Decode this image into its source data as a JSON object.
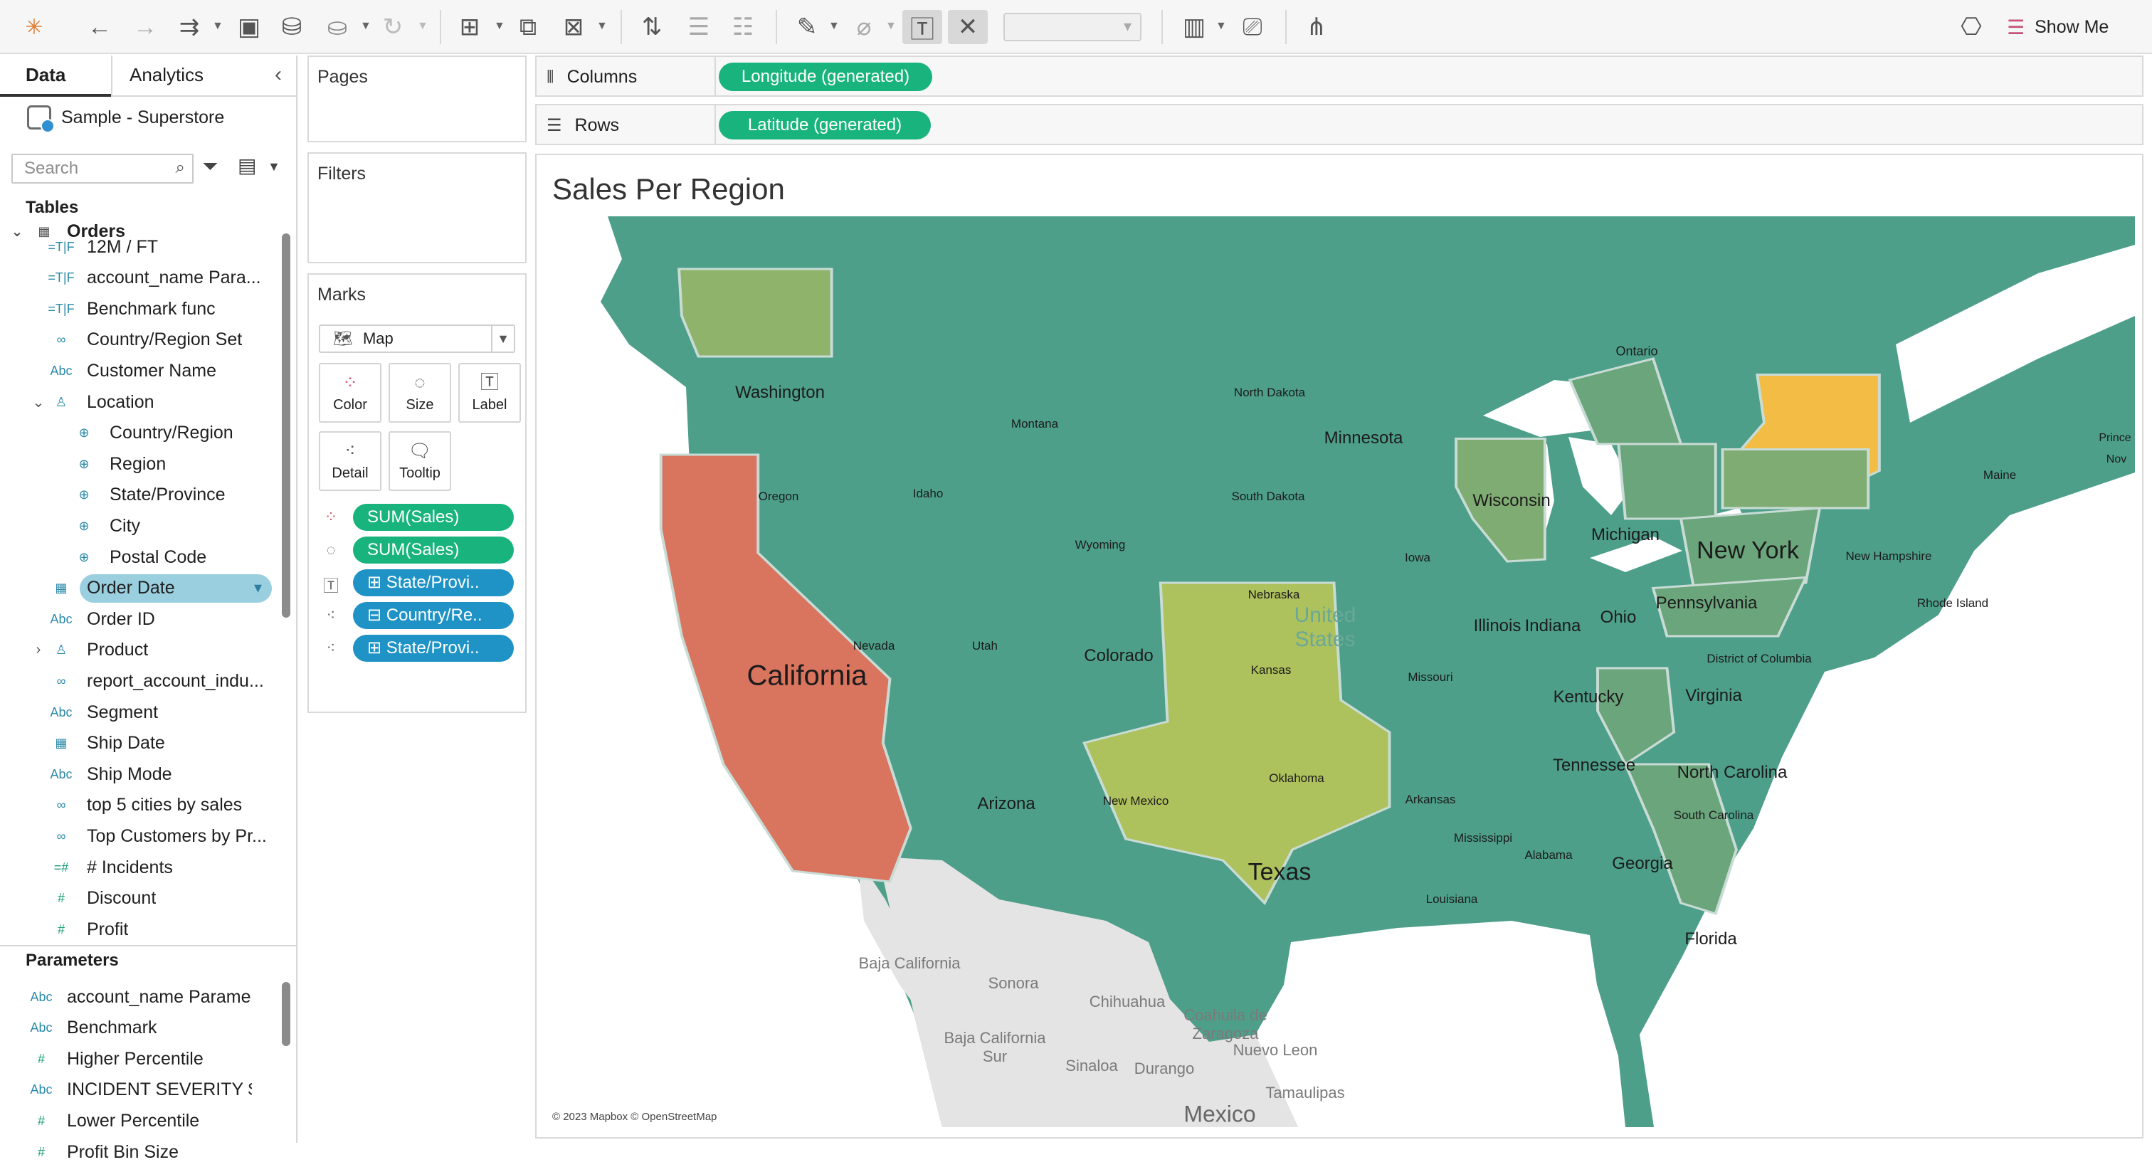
{
  "toolbar": {
    "show_me_label": "Show Me"
  },
  "left_pane": {
    "tabs": [
      "Data",
      "Analytics"
    ],
    "datasource": "Sample - Superstore",
    "search_placeholder": "Search",
    "tables_heading": "Tables",
    "orders_label": "Orders",
    "fields": [
      {
        "icon": "=T|F",
        "label": "12M / FT"
      },
      {
        "icon": "=T|F",
        "label": "account_name Para..."
      },
      {
        "icon": "=T|F",
        "label": "Benchmark func"
      },
      {
        "icon": "∞",
        "label": "Country/Region Set"
      },
      {
        "icon": "Abc",
        "label": "Customer Name"
      },
      {
        "icon": "♙",
        "label": "Location"
      },
      {
        "icon": "⊕",
        "label": "Country/Region"
      },
      {
        "icon": "⊕",
        "label": "Region"
      },
      {
        "icon": "⊕",
        "label": "State/Province"
      },
      {
        "icon": "⊕",
        "label": "City"
      },
      {
        "icon": "⊕",
        "label": "Postal Code"
      },
      {
        "icon": "▦",
        "label": "Order Date"
      },
      {
        "icon": "Abc",
        "label": "Order ID"
      },
      {
        "icon": "♙",
        "label": "Product"
      },
      {
        "icon": "∞",
        "label": "report_account_indu..."
      },
      {
        "icon": "Abc",
        "label": "Segment"
      },
      {
        "icon": "▦",
        "label": "Ship Date"
      },
      {
        "icon": "Abc",
        "label": "Ship Mode"
      },
      {
        "icon": "∞",
        "label": "top 5 cities by sales"
      },
      {
        "icon": "∞",
        "label": "Top Customers by Pr..."
      },
      {
        "icon": "=#",
        "label": "# Incidents"
      },
      {
        "icon": "#",
        "label": "Discount"
      },
      {
        "icon": "#",
        "label": "Profit"
      }
    ],
    "parameters_heading": "Parameters",
    "parameters": [
      {
        "icon": "Abc",
        "label": "account_name Parame..."
      },
      {
        "icon": "Abc",
        "label": "Benchmark"
      },
      {
        "icon": "#",
        "label": "Higher Percentile"
      },
      {
        "icon": "Abc",
        "label": "INCIDENT SEVERITY $ ..."
      },
      {
        "icon": "#",
        "label": "Lower Percentile"
      },
      {
        "icon": "#",
        "label": "Profit Bin Size"
      }
    ]
  },
  "cards": {
    "pages": "Pages",
    "filters": "Filters",
    "marks": "Marks",
    "mark_type": "Map",
    "mark_buttons": [
      "Color",
      "Size",
      "Label",
      "Detail",
      "Tooltip"
    ],
    "mark_pills": [
      {
        "icon": "color",
        "label": "SUM(Sales)",
        "kind": "green"
      },
      {
        "icon": "size",
        "label": "SUM(Sales)",
        "kind": "green"
      },
      {
        "icon": "label",
        "label": "⊞ State/Provi..",
        "kind": "blue"
      },
      {
        "icon": "detail",
        "label": "⊟ Country/Re..",
        "kind": "blue"
      },
      {
        "icon": "detail",
        "label": "⊞ State/Provi..",
        "kind": "blue"
      }
    ]
  },
  "shelves": {
    "columns_label": "Columns",
    "columns_pill": "Longitude (generated)",
    "rows_label": "Rows",
    "rows_pill": "Latitude (generated)"
  },
  "viz": {
    "title": "Sales Per Region",
    "credit": "© 2023 Mapbox © OpenStreetMap",
    "country_label": "United States",
    "colors": {
      "low": "#4d9f8a",
      "mid_low": "#8fb36a",
      "mid": "#adc15c",
      "high": "#f3bd45",
      "max": "#d9745f",
      "outside": "#e4e4e4",
      "water": "#ffffff"
    },
    "states": [
      {
        "name": "Washington",
        "size": "med",
        "color": "#8fb36a"
      },
      {
        "name": "Montana",
        "size": "small"
      },
      {
        "name": "North Dakota",
        "size": "small"
      },
      {
        "name": "Minnesota",
        "size": "med"
      },
      {
        "name": "Oregon",
        "size": "small"
      },
      {
        "name": "Idaho",
        "size": "small"
      },
      {
        "name": "South Dakota",
        "size": "small"
      },
      {
        "name": "Wisconsin",
        "size": "med"
      },
      {
        "name": "Michigan",
        "size": "med",
        "color": "#6ba57c"
      },
      {
        "name": "Wyoming",
        "size": "small"
      },
      {
        "name": "Iowa",
        "size": "small"
      },
      {
        "name": "Nebraska",
        "size": "small"
      },
      {
        "name": "Illinois",
        "size": "med",
        "color": "#7fac72"
      },
      {
        "name": "Indiana",
        "size": "med"
      },
      {
        "name": "Ohio",
        "size": "med",
        "color": "#6ba57c"
      },
      {
        "name": "Pennsylvania",
        "size": "med",
        "color": "#7fac72"
      },
      {
        "name": "New York",
        "size": "large",
        "color": "#f3bd45"
      },
      {
        "name": "California",
        "size": "xl",
        "color": "#d9745f"
      },
      {
        "name": "Nevada",
        "size": "small"
      },
      {
        "name": "Utah",
        "size": "small"
      },
      {
        "name": "Colorado",
        "size": "med"
      },
      {
        "name": "Kansas",
        "size": "small"
      },
      {
        "name": "Missouri",
        "size": "small"
      },
      {
        "name": "Kentucky",
        "size": "med"
      },
      {
        "name": "Virginia",
        "size": "med",
        "color": "#6ba57c"
      },
      {
        "name": "District of Columbia",
        "size": "small"
      },
      {
        "name": "Arizona",
        "size": "med"
      },
      {
        "name": "New Mexico",
        "size": "small"
      },
      {
        "name": "Oklahoma",
        "size": "small"
      },
      {
        "name": "Arkansas",
        "size": "small"
      },
      {
        "name": "Tennessee",
        "size": "med"
      },
      {
        "name": "North Carolina",
        "size": "med",
        "color": "#6ba57c"
      },
      {
        "name": "South Carolina",
        "size": "small"
      },
      {
        "name": "Mississippi",
        "size": "small"
      },
      {
        "name": "Alabama",
        "size": "small"
      },
      {
        "name": "Georgia",
        "size": "med",
        "color": "#6ba57c"
      },
      {
        "name": "Texas",
        "size": "large",
        "color": "#adc15c"
      },
      {
        "name": "Louisiana",
        "size": "small"
      },
      {
        "name": "Florida",
        "size": "med",
        "color": "#6ba57c"
      },
      {
        "name": "New Hampshire",
        "size": "small"
      },
      {
        "name": "Maine",
        "size": "small"
      },
      {
        "name": "Rhode Island",
        "size": "small"
      }
    ],
    "other_labels": [
      "Ontario",
      "Prince",
      "Nov",
      "Baja California",
      "Sonora",
      "Chihuahua",
      "Coahuila de Zaragoza",
      "Baja California Sur",
      "Sinaloa",
      "Durango",
      "Nuevo Leon",
      "Tamaulipas",
      "Mexico"
    ]
  }
}
